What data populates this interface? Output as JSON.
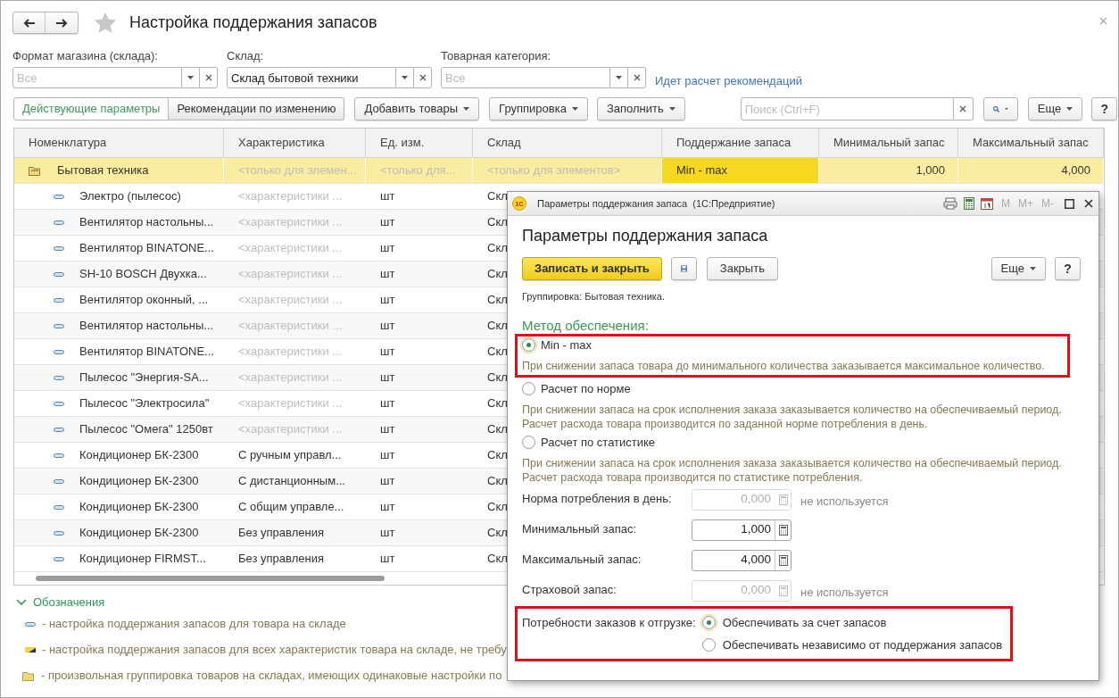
{
  "window": {
    "title": "Настройка поддержания запасов"
  },
  "filters": [
    {
      "label": "Формат магазина (склада):",
      "placeholder": "Все"
    },
    {
      "label": "Склад:",
      "value": "Склад бытовой техники"
    },
    {
      "label": "Товарная категория:",
      "placeholder": "Все"
    }
  ],
  "status_link": "Идет расчет рекомендаций",
  "view_tabs": [
    {
      "label": "Действующие параметры",
      "selected": true
    },
    {
      "label": "Рекомендации по изменению",
      "selected": false
    }
  ],
  "toolbar": [
    "Добавить товары",
    "Группировка",
    "Заполнить"
  ],
  "search": {
    "placeholder": "Поиск (Ctrl+F)"
  },
  "more_button": "Еще",
  "help_button": "?",
  "table": {
    "columns": [
      "Номенклатура",
      "Характеристика",
      "Ед. изм.",
      "Склад",
      "Поддержание запаса",
      "Минимальный запас",
      "Максимальный запас"
    ],
    "rows": [
      {
        "kind": "group",
        "selected": true,
        "cells": [
          {
            "text": "Бытовая техника",
            "dim": false,
            "focused": false
          },
          {
            "text": "<только для элемен...",
            "dim": true,
            "focused": false
          },
          {
            "text": "<только для...",
            "dim": true,
            "focused": false
          },
          {
            "text": "<только для элементов>",
            "dim": true,
            "focused": false
          },
          {
            "text": "Min - max",
            "dim": false,
            "focused": true
          },
          {
            "text": "1,000",
            "dim": false,
            "focused": false
          },
          {
            "text": "4,000",
            "dim": false,
            "focused": false
          }
        ]
      },
      {
        "kind": "item",
        "selected": false,
        "cells": [
          {
            "text": "Электро (пылесос)",
            "dim": false,
            "focused": false
          },
          {
            "text": "<характеристики ...",
            "dim": true,
            "focused": false
          },
          {
            "text": "шт",
            "dim": false,
            "focused": false
          },
          {
            "text": "Скл",
            "dim": false,
            "focused": false
          }
        ]
      },
      {
        "kind": "item",
        "selected": false,
        "cells": [
          {
            "text": "Вентилятор настольны...",
            "dim": false,
            "focused": false
          },
          {
            "text": "<характеристики ...",
            "dim": true,
            "focused": false
          },
          {
            "text": "шт",
            "dim": false,
            "focused": false
          },
          {
            "text": "Скл",
            "dim": false,
            "focused": false
          }
        ]
      },
      {
        "kind": "item",
        "selected": false,
        "cells": [
          {
            "text": "Вентилятор BINATONE...",
            "dim": false,
            "focused": false
          },
          {
            "text": "<характеристики ...",
            "dim": true,
            "focused": false
          },
          {
            "text": "шт",
            "dim": false,
            "focused": false
          },
          {
            "text": "Скл",
            "dim": false,
            "focused": false
          }
        ]
      },
      {
        "kind": "item",
        "selected": false,
        "cells": [
          {
            "text": "SH-10 BOSCH Двухка...",
            "dim": false,
            "focused": false
          },
          {
            "text": "<характеристики ...",
            "dim": true,
            "focused": false
          },
          {
            "text": "шт",
            "dim": false,
            "focused": false
          },
          {
            "text": "Скл",
            "dim": false,
            "focused": false
          }
        ]
      },
      {
        "kind": "item",
        "selected": false,
        "cells": [
          {
            "text": "Вентилятор оконный, ...",
            "dim": false,
            "focused": false
          },
          {
            "text": "<характеристики ...",
            "dim": true,
            "focused": false
          },
          {
            "text": "шт",
            "dim": false,
            "focused": false
          },
          {
            "text": "Скл",
            "dim": false,
            "focused": false
          }
        ]
      },
      {
        "kind": "item",
        "selected": false,
        "cells": [
          {
            "text": "Вентилятор настольны...",
            "dim": false,
            "focused": false
          },
          {
            "text": "<характеристики ...",
            "dim": true,
            "focused": false
          },
          {
            "text": "шт",
            "dim": false,
            "focused": false
          },
          {
            "text": "Скл",
            "dim": false,
            "focused": false
          }
        ]
      },
      {
        "kind": "item",
        "selected": false,
        "cells": [
          {
            "text": "Вентилятор BINATONE...",
            "dim": false,
            "focused": false
          },
          {
            "text": "<характеристики ...",
            "dim": true,
            "focused": false
          },
          {
            "text": "шт",
            "dim": false,
            "focused": false
          },
          {
            "text": "Скл",
            "dim": false,
            "focused": false
          }
        ]
      },
      {
        "kind": "item",
        "selected": false,
        "cells": [
          {
            "text": "Пылесос \"Энергия-SA...",
            "dim": false,
            "focused": false
          },
          {
            "text": "<характеристики ...",
            "dim": true,
            "focused": false
          },
          {
            "text": "шт",
            "dim": false,
            "focused": false
          },
          {
            "text": "Скл",
            "dim": false,
            "focused": false
          }
        ]
      },
      {
        "kind": "item",
        "selected": false,
        "cells": [
          {
            "text": "Пылесос \"Электросила\"",
            "dim": false,
            "focused": false
          },
          {
            "text": "<характеристики ...",
            "dim": true,
            "focused": false
          },
          {
            "text": "шт",
            "dim": false,
            "focused": false
          },
          {
            "text": "Скл",
            "dim": false,
            "focused": false
          }
        ]
      },
      {
        "kind": "item",
        "selected": false,
        "cells": [
          {
            "text": "Пылесос \"Омега\" 1250вт",
            "dim": false,
            "focused": false
          },
          {
            "text": "<характеристики ...",
            "dim": true,
            "focused": false
          },
          {
            "text": "шт",
            "dim": false,
            "focused": false
          },
          {
            "text": "Скл",
            "dim": false,
            "focused": false
          }
        ]
      },
      {
        "kind": "item",
        "selected": false,
        "cells": [
          {
            "text": "Кондиционер БК-2300",
            "dim": false,
            "focused": false
          },
          {
            "text": "С ручным управл...",
            "dim": false,
            "focused": false
          },
          {
            "text": "шт",
            "dim": false,
            "focused": false
          },
          {
            "text": "Скл",
            "dim": false,
            "focused": false
          }
        ]
      },
      {
        "kind": "item",
        "selected": false,
        "cells": [
          {
            "text": "Кондиционер БК-2300",
            "dim": false,
            "focused": false
          },
          {
            "text": "С дистанционным...",
            "dim": false,
            "focused": false
          },
          {
            "text": "шт",
            "dim": false,
            "focused": false
          },
          {
            "text": "Скл",
            "dim": false,
            "focused": false
          }
        ]
      },
      {
        "kind": "item",
        "selected": false,
        "cells": [
          {
            "text": "Кондиционер БК-2300",
            "dim": false,
            "focused": false
          },
          {
            "text": "С общим управле...",
            "dim": false,
            "focused": false
          },
          {
            "text": "шт",
            "dim": false,
            "focused": false
          },
          {
            "text": "Скл",
            "dim": false,
            "focused": false
          }
        ]
      },
      {
        "kind": "item",
        "selected": false,
        "cells": [
          {
            "text": "Кондиционер БК-2300",
            "dim": false,
            "focused": false
          },
          {
            "text": "Без управления",
            "dim": false,
            "focused": false
          },
          {
            "text": "шт",
            "dim": false,
            "focused": false
          },
          {
            "text": "Скл",
            "dim": false,
            "focused": false
          }
        ]
      },
      {
        "kind": "item",
        "selected": false,
        "cells": [
          {
            "text": "Кондиционер FIRMST...",
            "dim": false,
            "focused": false
          },
          {
            "text": "Без управления",
            "dim": false,
            "focused": false
          },
          {
            "text": "шт",
            "dim": false,
            "focused": false
          },
          {
            "text": "Скл",
            "dim": false,
            "focused": false
          }
        ]
      }
    ]
  },
  "legend": {
    "title": "Обозначения",
    "expanded": true,
    "items": [
      {
        "kind": "item",
        "text": "- настройка поддержания запасов для товара на складе"
      },
      {
        "kind": "all_characteristics",
        "text": "- настройка поддержания запасов для всех характеристик товара на складе, не требу"
      },
      {
        "kind": "group",
        "text": "- произвольная группировка товаров на складах, имеющих одинаковые настройки по"
      }
    ]
  },
  "dialog": {
    "logo": "1С",
    "window_title": "Параметры поддержания запаса  (1С:Предприятие)",
    "titlebar_buttons": [
      "M",
      "M+",
      "M-"
    ],
    "title": "Параметры поддержания запаса",
    "buttons": [
      {
        "kind": "primary",
        "label": "Записать и закрыть"
      },
      {
        "kind": "save"
      },
      {
        "kind": "default",
        "label": "Закрыть"
      }
    ],
    "more_button": "Еще",
    "help_button": "?",
    "grouping_note": "Группировка: Бытовая техника.",
    "method_label": "Метод обеспечения:",
    "methods": [
      {
        "label": "Min - max",
        "selected": true,
        "highlighted": true,
        "description": "При снижении запаса товара до минимального количества заказывается максимальное количество."
      },
      {
        "label": "Расчет по норме",
        "selected": false,
        "highlighted": false,
        "description": "При снижении запаса на срок исполнения заказа заказывается количество на обеспечиваемый период. Расчет расхода товара производится по заданной норме потребления в день."
      },
      {
        "label": "Расчет по статистике",
        "selected": false,
        "highlighted": false,
        "description": "При снижении запаса на срок исполнения заказа заказывается количество на обеспечиваемый период. Расчет расхода товара производится по статистике потребления."
      }
    ],
    "fields": [
      {
        "label": "Норма потребления в день:",
        "value": "0,000",
        "disabled": true,
        "note": "не используется"
      },
      {
        "label": "Минимальный запас:",
        "value": "1,000",
        "disabled": false
      },
      {
        "label": "Максимальный запас:",
        "value": "4,000",
        "disabled": false
      },
      {
        "label": "Страховой запас:",
        "value": "0,000",
        "disabled": true,
        "note": "не используется"
      }
    ],
    "shipping": {
      "label": "Потребности заказов к отгрузке:",
      "highlighted": true,
      "options": [
        {
          "label": "Обеспечивать за счет запасов",
          "selected": true
        },
        {
          "label": "Обеспечивать независимо от поддержания запасов",
          "selected": false
        }
      ]
    }
  }
}
